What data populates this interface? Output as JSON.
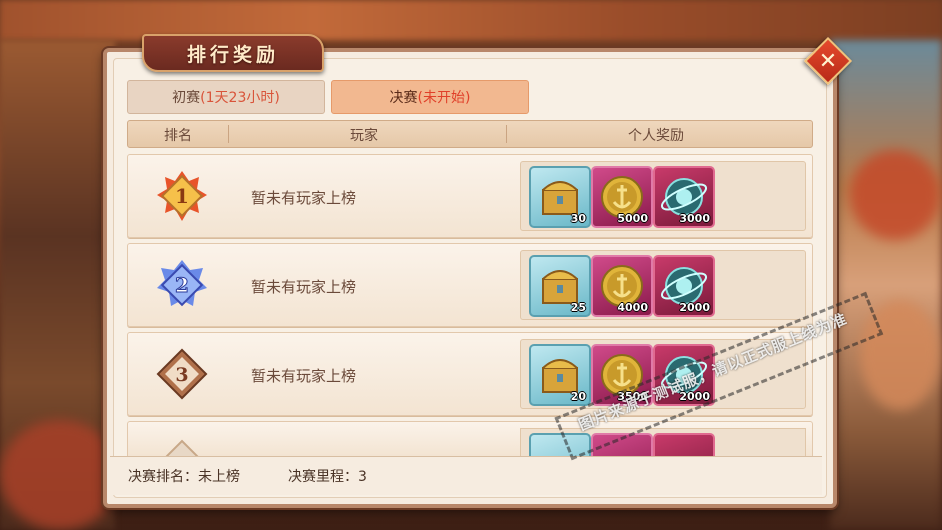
{
  "window": {
    "title": "排行奖励"
  },
  "tabs": [
    {
      "label": "初赛",
      "sub": "(1天23小时)"
    },
    {
      "label": "决赛",
      "sub": "(未开始)"
    }
  ],
  "table": {
    "headers": {
      "rank": "排名",
      "player": "玩家",
      "reward": "个人奖励"
    },
    "rows": [
      {
        "rank": "1",
        "player": "暂未有玩家上榜",
        "rewards": [
          {
            "icon": "treasure-chest-icon",
            "qty": "30"
          },
          {
            "icon": "anchor-coin-icon",
            "qty": "5000"
          },
          {
            "icon": "orb-icon",
            "qty": "3000"
          }
        ]
      },
      {
        "rank": "2",
        "player": "暂未有玩家上榜",
        "rewards": [
          {
            "icon": "treasure-chest-icon",
            "qty": "25"
          },
          {
            "icon": "anchor-coin-icon",
            "qty": "4000"
          },
          {
            "icon": "orb-icon",
            "qty": "2000"
          }
        ]
      },
      {
        "rank": "3",
        "player": "暂未有玩家上榜",
        "rewards": [
          {
            "icon": "treasure-chest-icon",
            "qty": "20"
          },
          {
            "icon": "anchor-coin-icon",
            "qty": "3500"
          },
          {
            "icon": "orb-icon",
            "qty": "2000"
          }
        ]
      }
    ]
  },
  "footer": {
    "rank_label": "决赛排名：未上榜",
    "mileage_label": "决赛里程：3"
  },
  "watermark": {
    "text": "图片来源于测试服，请以正式服上线为准"
  },
  "colors": {
    "accent": "#f2b890",
    "title_bg": "#7a3226",
    "panel_bg": "#f6ece0",
    "warn_text": "#e0402a"
  }
}
